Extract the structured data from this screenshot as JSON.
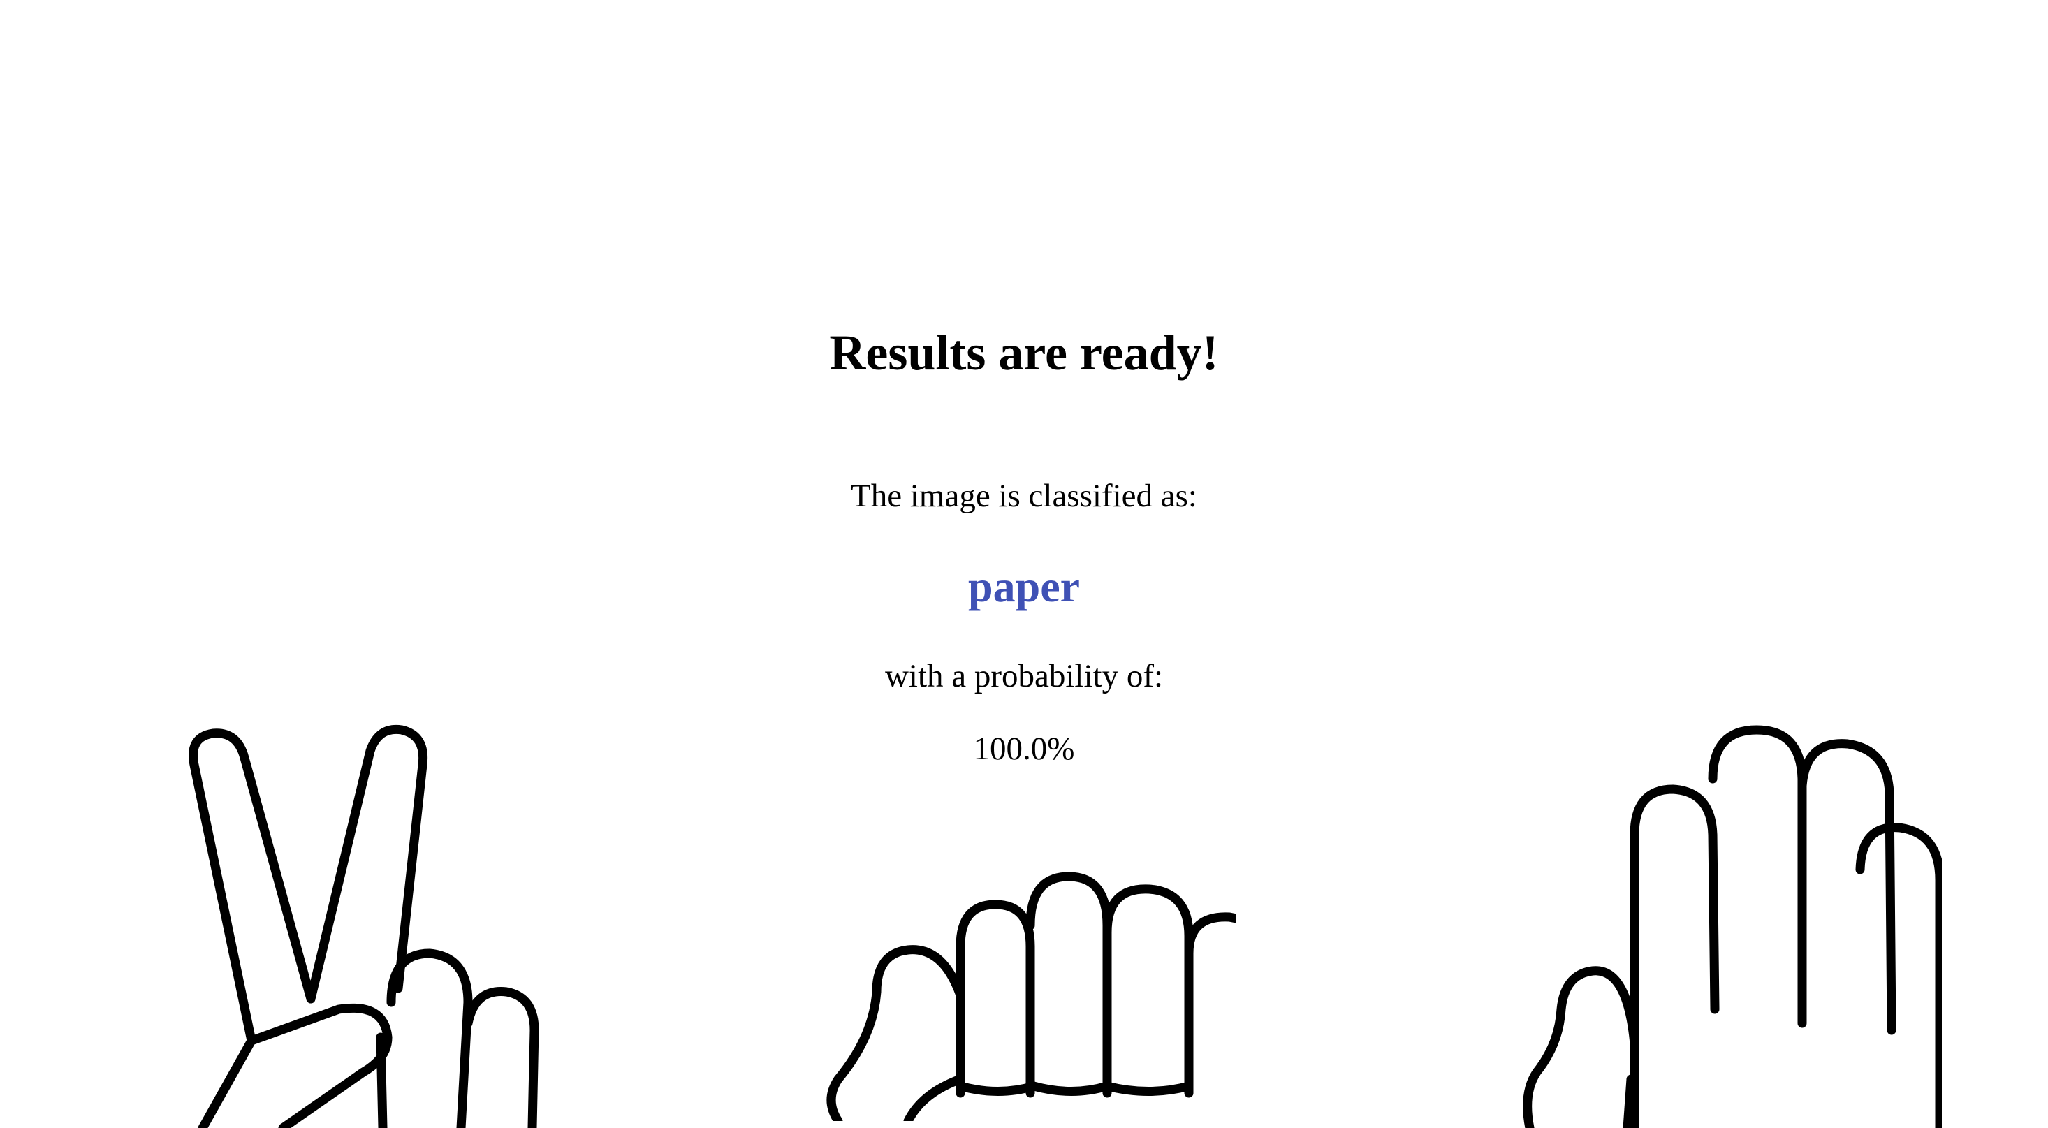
{
  "result": {
    "heading": "Results are ready!",
    "intro_text": "The image is classified as:",
    "label": "paper",
    "probability_text": "with a probability of:",
    "probability_value": "100.0%"
  },
  "colors": {
    "label": "#3f51b5",
    "text": "#000000",
    "background": "#ffffff"
  },
  "icons": [
    "scissors-hand-icon",
    "rock-fist-icon",
    "paper-hand-icon"
  ]
}
